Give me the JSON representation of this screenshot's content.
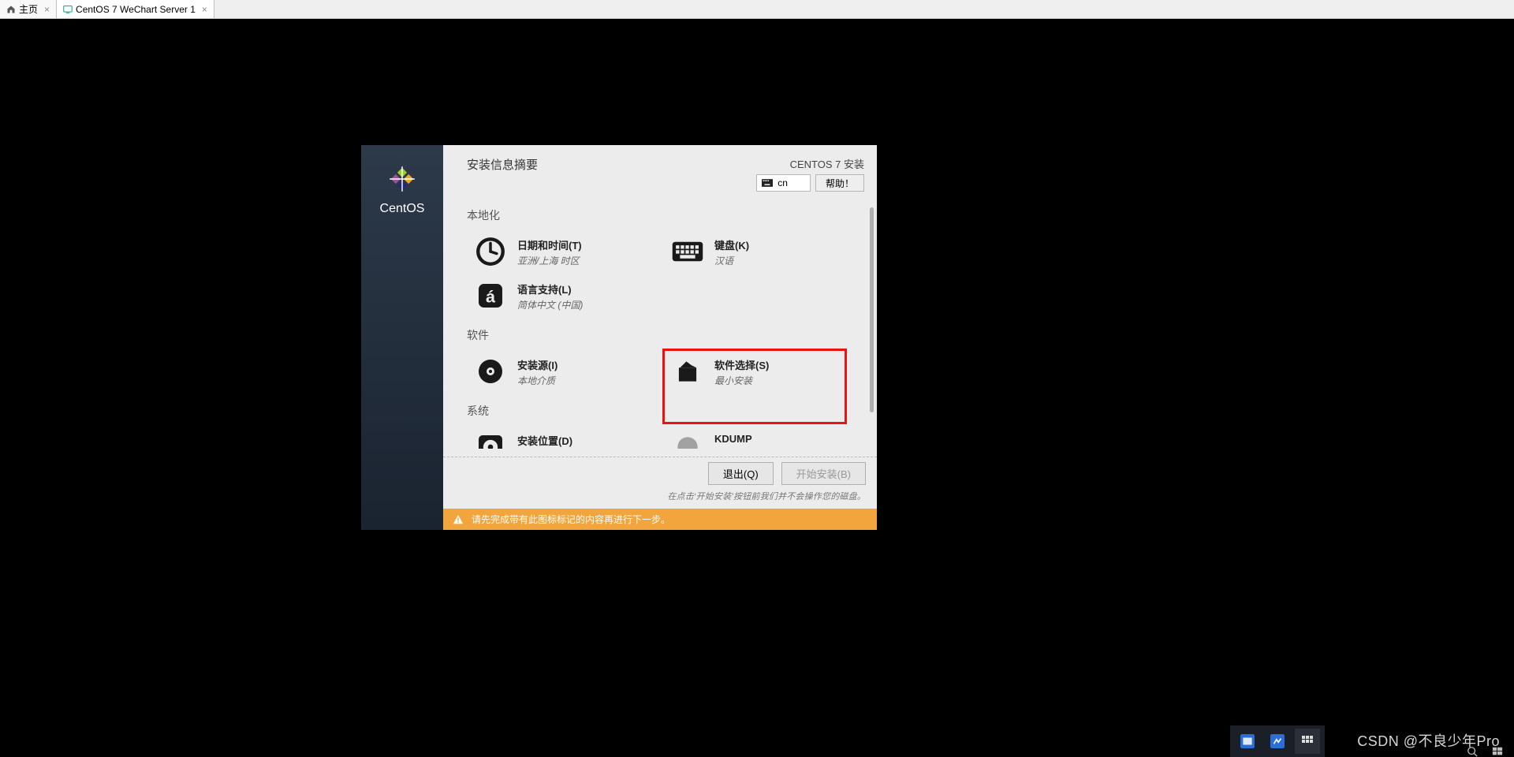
{
  "tabs": {
    "home": "主页",
    "vm": "CentOS 7 WeChart Server 1"
  },
  "sidebar": {
    "brand": "CentOS"
  },
  "header": {
    "title": "安装信息摘要",
    "install_label": "CENTOS 7 安装",
    "lang_code": "cn",
    "help_label": "帮助！"
  },
  "categories": {
    "local": "本地化",
    "software": "软件",
    "system": "系统"
  },
  "spokes": {
    "datetime": {
      "title": "日期和时间(T)",
      "sub": "亚洲/上海 时区"
    },
    "keyboard": {
      "title": "键盘(K)",
      "sub": "汉语"
    },
    "language": {
      "title": "语言支持(L)",
      "sub": "简体中文 (中国)"
    },
    "source": {
      "title": "安装源(I)",
      "sub": "本地介质"
    },
    "softsel": {
      "title": "软件选择(S)",
      "sub": "最小安装"
    },
    "dest": {
      "title": "安装位置(D)",
      "sub": ""
    },
    "kdump": {
      "title": "KDUMP",
      "sub": ""
    }
  },
  "footer": {
    "quit": "退出(Q)",
    "begin": "开始安装(B)",
    "hint": "在点击‘开始安装’按钮前我们并不会操作您的磁盘。"
  },
  "warning": "请先完成带有此图标标记的内容再进行下一步。",
  "watermark": "CSDN @不良少年Pro"
}
